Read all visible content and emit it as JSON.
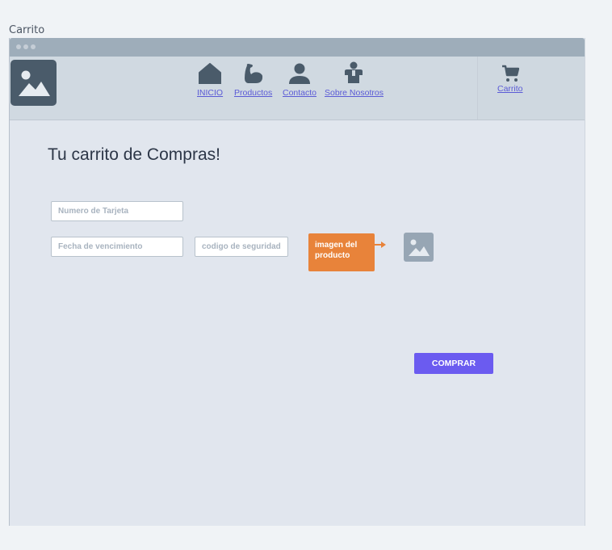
{
  "frame": {
    "label": "Carrito"
  },
  "nav": {
    "items": [
      {
        "label": "INICIO",
        "icon": "home-icon"
      },
      {
        "label": "Productos",
        "icon": "bicep-icon"
      },
      {
        "label": "Contacto",
        "icon": "person-icon"
      },
      {
        "label": "Sobre Nosotros",
        "icon": "team-person-icon"
      }
    ],
    "cart": {
      "label": "Carrito",
      "icon": "cart-icon"
    }
  },
  "logo": {
    "icon": "image-placeholder-icon"
  },
  "main": {
    "title": "Tu carrito de Compras!",
    "card_number": {
      "placeholder": "Numero de Tarjeta",
      "value": ""
    },
    "expiry": {
      "placeholder": "Fecha de vencimiento",
      "value": ""
    },
    "security": {
      "placeholder": "codigo de seguridad",
      "value": ""
    },
    "tooltip": {
      "line1": "imagen del",
      "line2": "producto"
    },
    "product_image": {
      "icon": "image-placeholder-icon"
    },
    "buy_button": {
      "label": "COMPRAR"
    }
  },
  "colors": {
    "accent": "#6b5bf0",
    "link": "#5b5bd6",
    "tooltip": "#e8833a",
    "icon_dark": "#4a5b6a"
  }
}
